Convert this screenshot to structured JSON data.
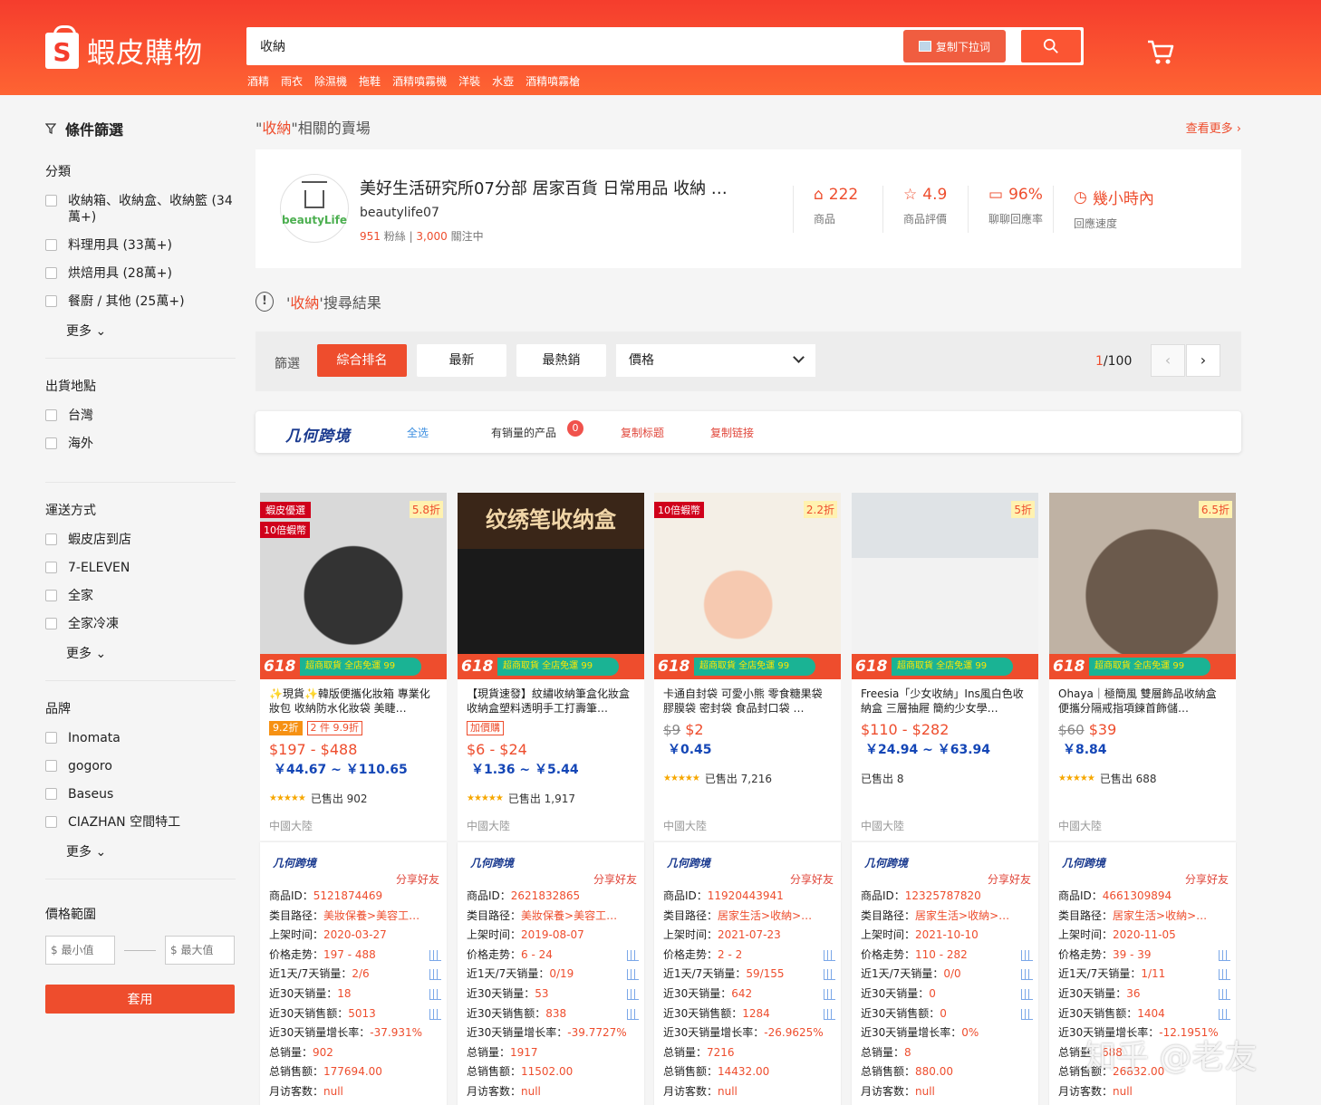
{
  "header": {
    "logo_text": "蝦皮購物",
    "logo_letter": "S",
    "search_value": "收納",
    "copy_button": "复制下拉词",
    "keywords": [
      "酒精",
      "雨衣",
      "除濕機",
      "拖鞋",
      "酒精噴霧機",
      "洋裝",
      "水壺",
      "酒精噴霧槍"
    ]
  },
  "sidebar": {
    "filter_title": "條件篩選",
    "sections": [
      {
        "title": "分類",
        "items": [
          "收納箱、收納盒、收納籃 (34萬+)",
          "料理用具 (33萬+)",
          "烘焙用具 (28萬+)",
          "餐廚 / 其他 (25萬+)"
        ],
        "more": "更多"
      },
      {
        "title": "出貨地點",
        "items": [
          "台灣",
          "海外"
        ]
      },
      {
        "title": "運送方式",
        "items": [
          "蝦皮店到店",
          "7-ELEVEN",
          "全家",
          "全家冷凍"
        ],
        "more": "更多"
      },
      {
        "title": "品牌",
        "items": [
          "Inomata",
          "gogoro",
          "Baseus",
          "CIAZHAN 空間特工"
        ],
        "more": "更多"
      }
    ],
    "price_title": "價格範圍",
    "price_min_placeholder": "$ 最小值",
    "price_max_placeholder": "$ 最大值",
    "apply": "套用"
  },
  "related": {
    "quote_open": "\"",
    "keyword": "收納",
    "quote_rest": "\"相關的賣場",
    "see_more": "查看更多 ›"
  },
  "shop": {
    "name": "美好生活研究所07分部 居家百貨 日常用品 收納 …",
    "username": "beautylife07",
    "avatar_text": "beautyLife",
    "fans_count": "951",
    "fans_label": "粉絲",
    "following_count": "3,000",
    "following_label": "關注中",
    "stats": [
      {
        "value": "222",
        "label": "商品",
        "icon": "store-icon"
      },
      {
        "value": "4.9",
        "label": "商品評價",
        "icon": "star-icon"
      },
      {
        "value": "96%",
        "label": "聊聊回應率",
        "icon": "chat-icon"
      },
      {
        "value": "幾小時內",
        "label": "回應速度",
        "icon": "clock-icon"
      }
    ]
  },
  "results": {
    "prefix": "'",
    "keyword": "收納",
    "suffix": "'搜尋結果"
  },
  "sort": {
    "label": "篩選",
    "options": [
      "綜合排名",
      "最新",
      "最熱銷"
    ],
    "price_label": "價格",
    "page_current": "1",
    "page_total": "/100"
  },
  "extension": {
    "brand": "几何跨境",
    "select_all": "全选",
    "with_sales": "有销量的产品",
    "badge": "0",
    "copy_title": "复制标题",
    "copy_link": "复制链接"
  },
  "products": [
    {
      "name": "✨現貨✨韓版便攜化妝箱 專業化妝包 收納防水化妝袋 美睫…",
      "discount": "5.8折",
      "tag1": "蝦皮優選",
      "tag2": "10倍蝦幣",
      "chips": [
        "9.2折",
        "2 件 9.9折"
      ],
      "price_old": "",
      "price": "$197 - $488",
      "cny": "￥44.67 ~ ￥110.65",
      "sold": "已售出 902",
      "location": "中國大陸",
      "img_caption": ""
    },
    {
      "name": "【現貨速發】紋繡收納筆盒化妝盒收納盒塑料透明手工打壽筆…",
      "discount": "",
      "tag1": "",
      "tag2": "",
      "chips": [
        "加價購"
      ],
      "price_old": "",
      "price": "$6 - $24",
      "cny": "￥1.36 ~ ￥5.44",
      "sold": "已售出 1,917",
      "location": "中國大陸",
      "img_caption": "纹绣笔收纳盒"
    },
    {
      "name": "卡通自封袋 可愛小熊 零食糖果袋 膠膜袋 密封袋 食品封口袋 …",
      "discount": "2.2折",
      "tag1": "",
      "tag2": "10倍蝦幣",
      "chips": [],
      "price_old": "$9",
      "price": "$2",
      "cny": "￥0.45",
      "sold": "已售出 7,216",
      "location": "中國大陸",
      "img_caption": ""
    },
    {
      "name": "Freesia「少女收納」Ins風白色收納盒 三層抽屜 簡約少女學…",
      "discount": "5折",
      "tag1": "",
      "tag2": "",
      "chips": [],
      "price_old": "",
      "price": "$110 - $282",
      "cny": "￥24.94 ~ ￥63.94",
      "sold": "已售出 8",
      "location": "中國大陸",
      "img_caption": ""
    },
    {
      "name": "Ohaya｜極簡風 雙層飾品收納盒 便攜分隔戒指項鍊首飾儲…",
      "discount": "6.5折",
      "tag1": "",
      "tag2": "",
      "chips": [],
      "price_old": "$60",
      "price": "$39",
      "cny": "￥8.84",
      "sold": "已售出 688",
      "location": "中國大陸",
      "img_caption": ""
    }
  ],
  "info_labels": [
    "商品ID：",
    "类目路径：",
    "上架时间：",
    "价格走势：",
    "近1天/7天销量：",
    "近30天销量：",
    "近30天销售额：",
    "近30天销量增长率：",
    "总销量：",
    "总销售额：",
    "月访客数："
  ],
  "info_brand": "几何跨境",
  "info_share": "分享好友",
  "infos": [
    [
      "5121874469",
      "美妝保養>美容工…",
      "2020-03-27",
      "197 - 488",
      "2/6",
      "18",
      "5013",
      "-37.931%",
      "902",
      "177694.00",
      "null"
    ],
    [
      "2621832865",
      "美妝保養>美容工…",
      "2019-08-07",
      "6 - 24",
      "0/19",
      "53",
      "838",
      "-39.7727%",
      "1917",
      "11502.00",
      "null"
    ],
    [
      "11920443941",
      "居家生活>收納>…",
      "2021-07-23",
      "2 - 2",
      "59/155",
      "642",
      "1284",
      "-26.9625%",
      "7216",
      "14432.00",
      "null"
    ],
    [
      "12325787820",
      "居家生活>收納>…",
      "2021-10-10",
      "110 - 282",
      "0/0",
      "0",
      "0",
      "0%",
      "8",
      "880.00",
      "null"
    ],
    [
      "4661309894",
      "居家生活>收納>…",
      "2020-11-05",
      "39 - 39",
      "1/11",
      "36",
      "1404",
      "-12.1951%",
      "688",
      "26832.00",
      "null"
    ]
  ],
  "watermark": "知乎 @老友",
  "strip": {
    "sale": "618",
    "promo": "超商取貨 全店免運 99"
  }
}
